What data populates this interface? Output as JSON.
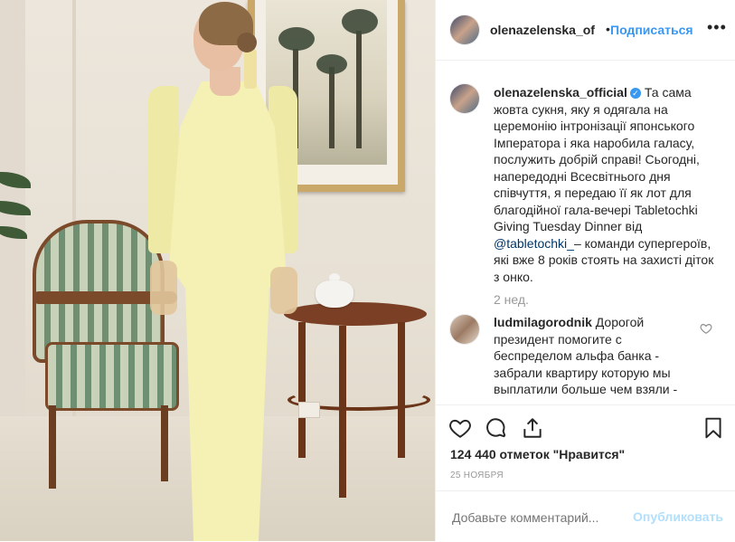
{
  "header": {
    "username": "olenazelenska_of",
    "separator": "•",
    "follow_label": "Подписаться",
    "more_label": "•••"
  },
  "caption": {
    "username": "olenazelenska_official",
    "verified": "✓",
    "text_before_mention": "Та сама жовта сукня, яку я одягала на церемонію інтронізації японського Імператора і яка наробила галасу, послужить добрій справі! Сьогодні, напередодні Всесвітнього дня співчуття, я передаю її як лот для благодійної гала-вечері Tabletochki Giving Tuesday Dinner від",
    "mention": "@tabletochki_",
    "text_after_mention": "– команди супергероїв, які вже 8 років стоять на захисті діток з онко.",
    "time_ago": "2 нед."
  },
  "comment": {
    "username": "ludmilagorodnik",
    "text": "Дорогой президент помогите с беспределом альфа банка - забрали квартиру которую мы выплатили больше чем взяли -"
  },
  "actions": {
    "icons": [
      "heart-icon",
      "comment-icon",
      "share-icon",
      "bookmark-icon"
    ]
  },
  "likes_label": "124 440 отметок \"Нравится\"",
  "date_label": "25 НОЯБРЯ",
  "add_comment": {
    "placeholder": "Добавьте комментарий...",
    "publish_label": "Опубликовать"
  },
  "colors": {
    "link": "#3897f0",
    "publish_disabled": "#b2dffc",
    "muted": "#999999",
    "dress": "#f5f0b3"
  }
}
